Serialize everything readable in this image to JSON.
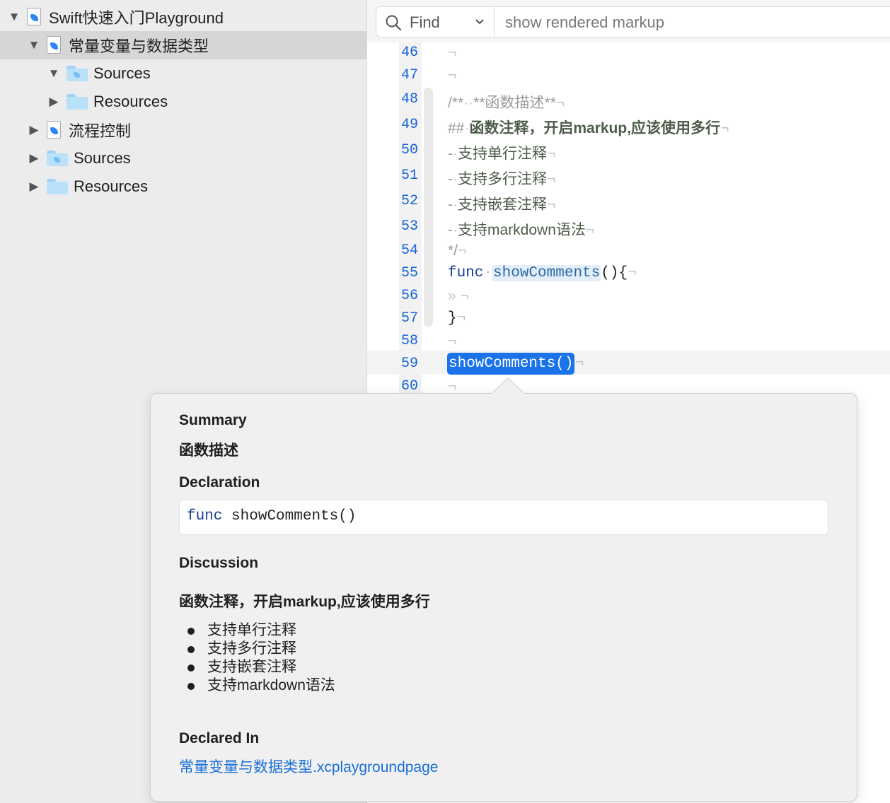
{
  "sidebar": {
    "items": [
      {
        "label": "Swift快速入门Playground",
        "expanded": true,
        "icon": "swift-file-icon"
      },
      {
        "label": "常量变量与数据类型",
        "expanded": true,
        "icon": "swift-file-icon",
        "selected": true
      },
      {
        "label": "Sources",
        "expanded": true,
        "icon": "sources-folder-icon"
      },
      {
        "label": "Resources",
        "expanded": false,
        "icon": "folder-icon"
      },
      {
        "label": "流程控制",
        "expanded": false,
        "icon": "swift-file-icon"
      },
      {
        "label": "Sources",
        "expanded": false,
        "icon": "sources-folder-icon"
      },
      {
        "label": "Resources",
        "expanded": false,
        "icon": "folder-icon"
      }
    ],
    "disclosure_open": "▼",
    "disclosure_closed": "▶"
  },
  "findbar": {
    "mode_label": "Find",
    "chevron": "⌄",
    "query": "show rendered markup"
  },
  "editor": {
    "invisible_mark": "¬",
    "space_mark": "·",
    "tab_mark": "»",
    "lines": [
      {
        "num": "46"
      },
      {
        "num": "47"
      },
      {
        "num": "48",
        "a": "/**",
        "b": "**函数描述**"
      },
      {
        "num": "49",
        "a": "##",
        "b": "函数注释，开启markup,应该使用多行"
      },
      {
        "num": "50",
        "a": "-",
        "b": "支持单行注释"
      },
      {
        "num": "51",
        "a": "-",
        "b": "支持多行注释"
      },
      {
        "num": "52",
        "a": "-",
        "b": "支持嵌套注释"
      },
      {
        "num": "53",
        "a": "-",
        "b": "支持markdown语法"
      },
      {
        "num": "54",
        "a": "*/"
      },
      {
        "num": "55",
        "kw": "func",
        "fn": "showComments",
        "rest": "(){"
      },
      {
        "num": "56"
      },
      {
        "num": "57",
        "a": "}"
      },
      {
        "num": "58"
      },
      {
        "num": "59",
        "call": "showComments()"
      },
      {
        "num": "60"
      }
    ]
  },
  "quickhelp": {
    "summary_heading": "Summary",
    "summary_text": "函数描述",
    "declaration_heading": "Declaration",
    "declaration_kw": "func",
    "declaration_rest": "showComments()",
    "discussion_heading": "Discussion",
    "discussion_title": "函数注释，开启markup,应该使用多行",
    "bullets": [
      "支持单行注释",
      "支持多行注释",
      "支持嵌套注释",
      "支持markdown语法"
    ],
    "declared_in_heading": "Declared In",
    "declared_in_link": "常量变量与数据类型.xcplaygroundpage"
  },
  "colors": {
    "line_number": "#1563d6",
    "keyword": "#1c3f94",
    "selection": "#1a73e8",
    "link": "#1a6fd6"
  }
}
